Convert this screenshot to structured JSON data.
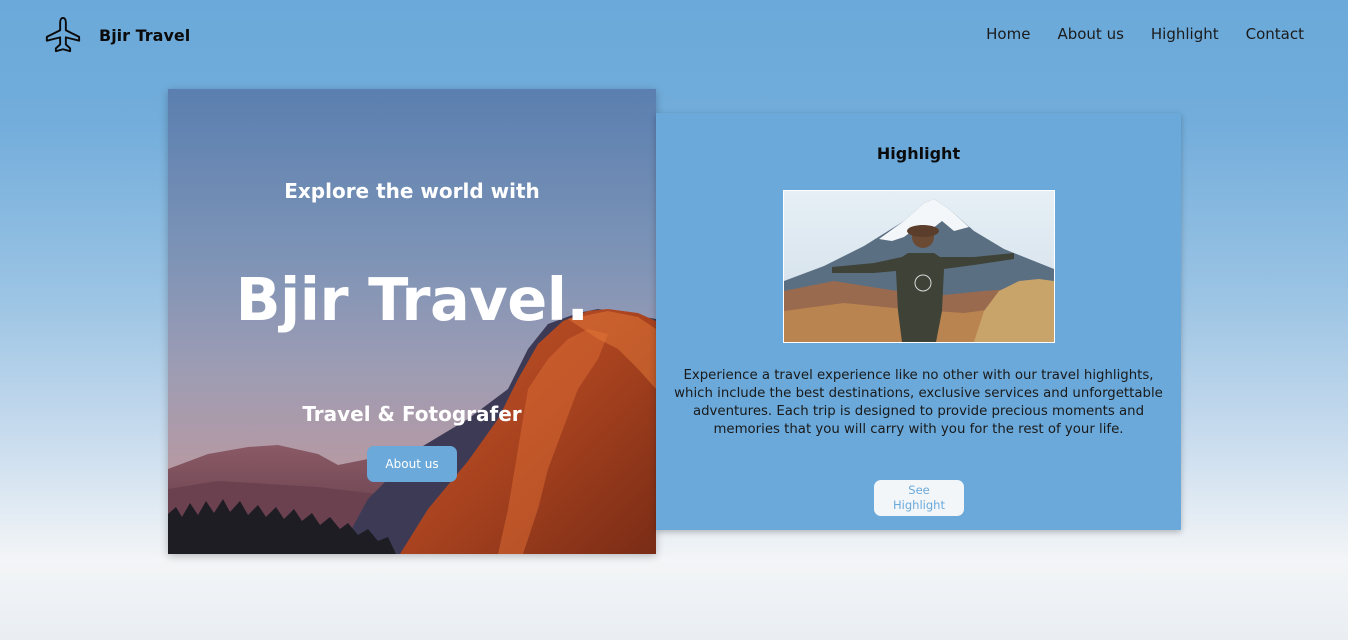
{
  "header": {
    "brand_icon": "airplane-icon",
    "brand_name": "Bjir Travel",
    "nav": [
      {
        "label": "Home"
      },
      {
        "label": "About us"
      },
      {
        "label": "Highlight"
      },
      {
        "label": "Contact"
      }
    ]
  },
  "hero": {
    "kicker": "Explore the world with",
    "title": "Bjir Travel.",
    "subtitle": "Travel & Fotografer",
    "button_label": "About us"
  },
  "highlight": {
    "title": "Highlight",
    "description": "Experience a travel experience like no other with our travel highlights, which include the best destinations, exclusive services and unforgettable adventures. Each trip is designed to provide precious moments and memories that you will carry with you for the rest of your life.",
    "button_label": "See Highlight"
  },
  "colors": {
    "accent": "#6aa9da",
    "text_dark": "#0b0b0b",
    "button_light": "#f3f6f9"
  }
}
